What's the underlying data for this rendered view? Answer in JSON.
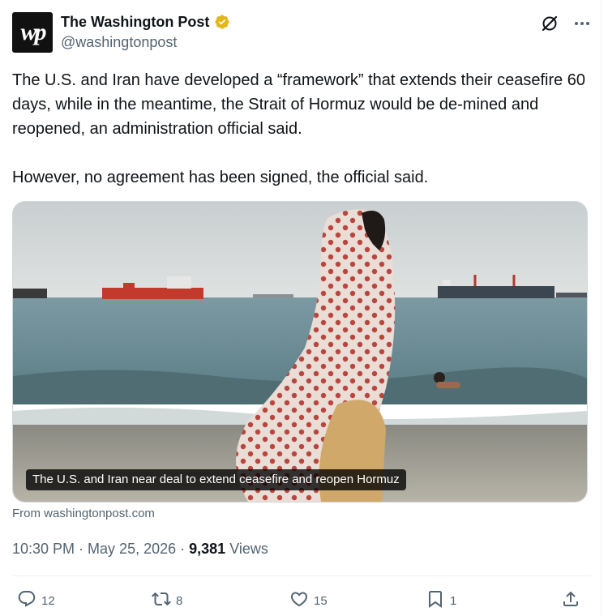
{
  "author": {
    "display_name": "The Washington Post",
    "handle": "@washingtonpost",
    "avatar_text": "wp",
    "verified_color": "#e2b719"
  },
  "tweet": {
    "text": "The U.S. and Iran have developed a “framework” that extends their ceasefire 60 days, while in the meantime, the Strait of Hormuz would be de-mined and reopened, an administration official said.\n\nHowever, no agreement has been signed, the official said."
  },
  "media": {
    "caption": "The U.S. and Iran near deal to extend ceasefire and reopen Hormuz"
  },
  "source": "From washingtonpost.com",
  "meta": {
    "time": "10:30 PM",
    "separator": " · ",
    "date": "May 25, 2026",
    "views_count": "9,381",
    "views_label": "Views"
  },
  "actions": {
    "replies": "12",
    "reposts": "8",
    "likes": "15",
    "bookmarks": "1"
  },
  "icons": [
    "grok-icon",
    "more-icon",
    "verified-icon",
    "reply-icon",
    "repost-icon",
    "like-icon",
    "bookmark-icon",
    "share-icon"
  ],
  "colors": {
    "text": "#0f1419",
    "secondary": "#536471",
    "border": "#eff3f4"
  }
}
